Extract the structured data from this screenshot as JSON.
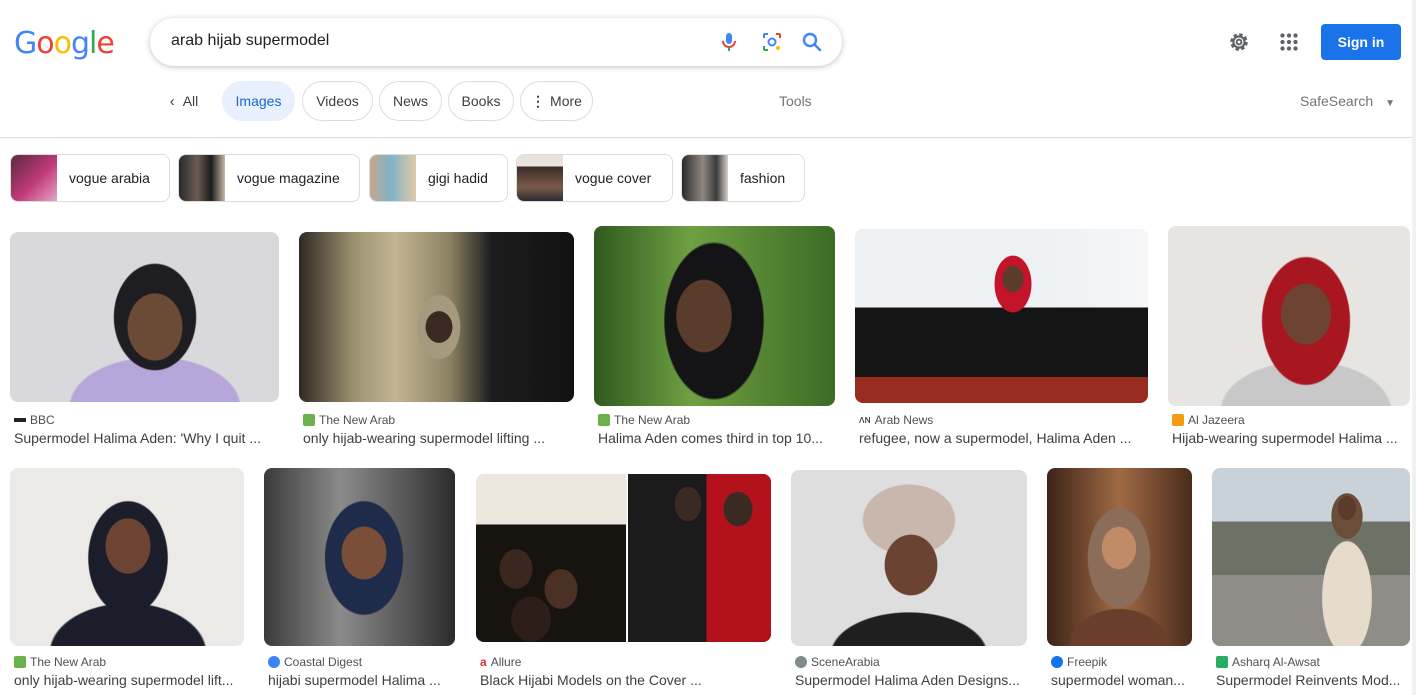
{
  "logo": {
    "letters": [
      "G",
      "o",
      "o",
      "g",
      "l",
      "e"
    ],
    "colors": [
      "#4285f4",
      "#ea4335",
      "#fbbc05",
      "#4285f4",
      "#34a853",
      "#ea4335"
    ]
  },
  "search": {
    "query": "arab hijab supermodel"
  },
  "header": {
    "sign_in": "Sign in"
  },
  "nav": {
    "back": "All",
    "tabs": [
      "Images",
      "Videos",
      "News",
      "Books",
      "More"
    ],
    "tools": "Tools",
    "safesearch": "SafeSearch"
  },
  "refinements": [
    "vogue arabia",
    "vogue magazine",
    "gigi hadid",
    "vogue cover",
    "fashion"
  ],
  "results_row1": [
    {
      "source": "BBC",
      "title": "Supermodel Halima Aden: 'Why I quit ...",
      "favicon": "#222222"
    },
    {
      "source": "The New Arab",
      "title": "only hijab-wearing supermodel lifting ...",
      "favicon": "#6ab04c"
    },
    {
      "source": "The New Arab",
      "title": "Halima Aden comes third in top 10...",
      "favicon": "#6ab04c"
    },
    {
      "source": "Arab News",
      "title": "refugee, now a supermodel, Halima Aden ...",
      "favicon": "#333333"
    },
    {
      "source": "Al Jazeera",
      "title": "Hijab-wearing supermodel Halima ...",
      "favicon": "#f39c12"
    }
  ],
  "results_row2": [
    {
      "source": "The New Arab",
      "title": "only hijab-wearing supermodel lift...",
      "favicon": "#6ab04c"
    },
    {
      "source": "Coastal Digest",
      "title": "hijabi supermodel Halima ...",
      "favicon": "#3b82f6"
    },
    {
      "source": "Allure",
      "title": "Black Hijabi Models on the Cover ...",
      "favicon": "#d63031"
    },
    {
      "source": "SceneArabia",
      "title": "Supermodel Halima Aden Designs...",
      "favicon": "#7f8c8d"
    },
    {
      "source": "Freepik",
      "title": "supermodel woman...",
      "favicon": "#1273eb"
    },
    {
      "source": "Asharq Al-Awsat",
      "title": "Supermodel Reinvents Mod...",
      "favicon": "#27ae60"
    }
  ]
}
